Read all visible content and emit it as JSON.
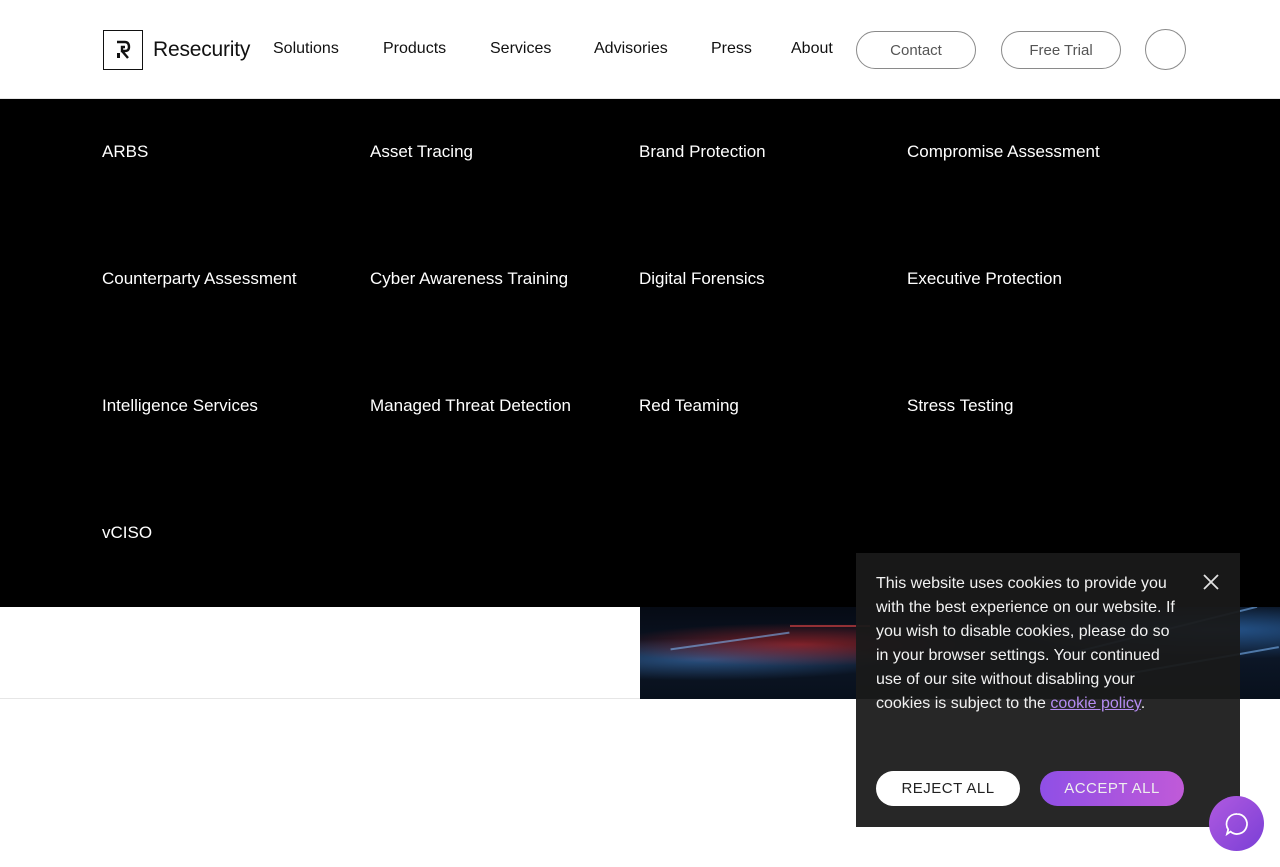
{
  "header": {
    "logo_text": "Resecurity",
    "nav": [
      "Solutions",
      "Products",
      "Services",
      "Advisories",
      "Press",
      "About"
    ],
    "contact_label": "Contact",
    "trial_label": "Free Trial"
  },
  "services_menu": [
    "ARBS",
    "Asset Tracing",
    "Brand Protection",
    "Compromise Assessment",
    "Counterparty Assessment",
    "Cyber Awareness Training",
    "Digital Forensics",
    "Executive Protection",
    "Intelligence Services",
    "Managed Threat Detection",
    "Red Teaming",
    "Stress Testing",
    "vCISO"
  ],
  "cookie": {
    "text": "This website uses cookies to provide you with the best experience on our website. If you wish to disable cookies, please do so in your browser settings. Your continued use of our site without disabling your cookies is subject to the ",
    "link": "cookie policy",
    "end": ".",
    "reject": "REJECT ALL",
    "accept": "ACCEPT ALL"
  },
  "icons": {
    "logo": "resecurity-logo-icon",
    "close": "close-icon",
    "chat": "chat-bubble-icon",
    "search": "search-icon"
  },
  "colors": {
    "menu_bg": "#000000",
    "accent_gradient_start": "#8f4fe6",
    "accent_gradient_end": "#c05ad8",
    "cookie_link": "#b58cf2"
  }
}
